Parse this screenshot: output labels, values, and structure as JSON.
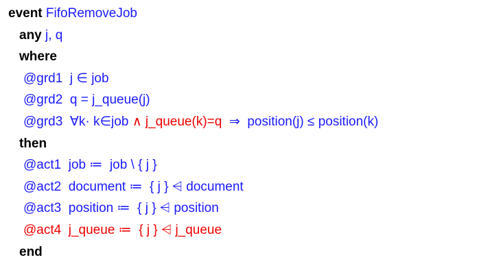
{
  "event": {
    "keyword": "event",
    "name": " FifoRemoveJob"
  },
  "any": {
    "keyword": "any",
    "params": " j, q"
  },
  "where": {
    "keyword": "where"
  },
  "guards": [
    {
      "label": "@grd1",
      "expr": "  j ∈ job"
    },
    {
      "label": "@grd2",
      "expr": "  q = j_queue(j)"
    },
    {
      "label": "@grd3",
      "expr_a": "  ∀k· k∈job ",
      "expr_b": "∧ j_queue(k)=q",
      "expr_c": "  ⇒  position(j) ≤ position(k)"
    }
  ],
  "then": {
    "keyword": "then"
  },
  "actions": [
    {
      "label": "@act1",
      "expr": "  job ≔  job \\ { j }"
    },
    {
      "label": "@act2",
      "expr": "  document ≔  { j } ⩤ document"
    },
    {
      "label": "@act3",
      "expr": "  position ≔  { j } ⩤ position"
    },
    {
      "label": "@act4",
      "expr": "  j_queue ≔  { j } ⩤ j_queue"
    }
  ],
  "end": {
    "keyword": "end"
  },
  "colors": {
    "keyword": "#000000",
    "blue": "#1a1aff",
    "red": "#ee0000"
  }
}
